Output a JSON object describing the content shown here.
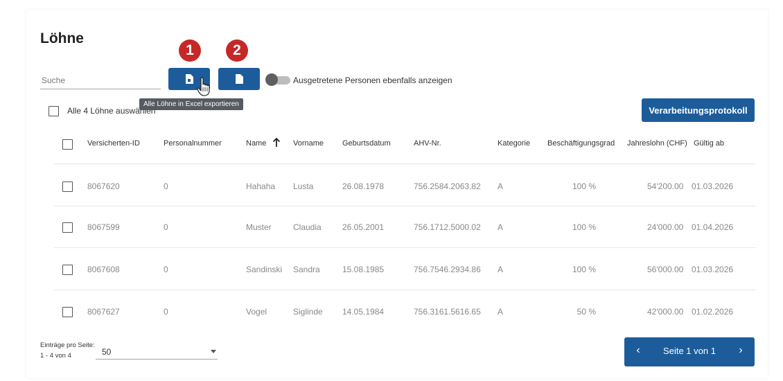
{
  "page": {
    "title": "Löhne"
  },
  "markers": [
    "1",
    "2"
  ],
  "search": {
    "placeholder": "Suche",
    "value": ""
  },
  "toolbar": {
    "excel_export_icon": "document-icon",
    "export_icon": "document-icon",
    "toggle_label": "Ausgetretene Personen ebenfalls anzeigen",
    "toggle_on": false,
    "tooltip": "Alle Löhne in Excel exportieren"
  },
  "select_all": {
    "label": "Alle 4 Löhne auswählen"
  },
  "protocol_button": {
    "label": "Verarbeitungsprotokoll"
  },
  "table": {
    "headers": [
      "Versicherten-ID",
      "Personalnummer",
      "Name",
      "Vorname",
      "Geburtsdatum",
      "AHV-Nr.",
      "Kategorie",
      "Beschäftigungsgrad",
      "Jahreslohn (CHF)",
      "Gültig ab"
    ],
    "rows": [
      [
        "8067620",
        "0",
        "Hahaha",
        "Lusta",
        "26.08.1978",
        "756.2584.2063.82",
        "A",
        "100 %",
        "54'200.00",
        "01.03.2026"
      ],
      [
        "8067599",
        "0",
        "Muster",
        "Claudia",
        "26.05.2001",
        "756.1712.5000.02",
        "A",
        "100 %",
        "24'000.00",
        "01.04.2026"
      ],
      [
        "8067608",
        "0",
        "Sandinski",
        "Sandra",
        "15.08.1985",
        "756.7546.2934.86",
        "A",
        "100 %",
        "56'000.00",
        "01.03.2026"
      ],
      [
        "8067627",
        "0",
        "Vogel",
        "Siglinde",
        "14.05.1984",
        "756.3161.5616.65",
        "A",
        "50 %",
        "42'000.00",
        "01.02.2026"
      ]
    ]
  },
  "footer": {
    "per_page_label": "Einträge pro Seite:",
    "range_label": "1 - 4 von 4",
    "per_page_value": "50",
    "pager_text": "Seite 1 von 1",
    "prev_symbol": "‹",
    "next_symbol": "›"
  },
  "colors": {
    "primary": "#1d5c9a",
    "marker": "#c62828",
    "tooltip_bg": "#555b60"
  }
}
